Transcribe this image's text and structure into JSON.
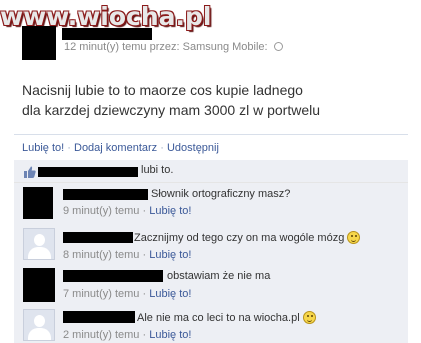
{
  "watermark": "www.wiocha.pl",
  "post": {
    "meta_time": "12 minut(y) temu przez:",
    "meta_source": "Samsung Mobile",
    "meta_dot": "·",
    "text": "Nacisnij lubie to to maorze cos kupie ladnego dla karzdej dziewczyny mam 3000 zl w portwelu"
  },
  "actions": {
    "like": "Lubię to!",
    "comment": "Dodaj komentarz",
    "share": "Udostępnij",
    "separator": "·"
  },
  "likes": {
    "text": "lubi to."
  },
  "comments": [
    {
      "text": "Słownik ortograficzny masz?",
      "time": "9 minut(y) temu",
      "like": "Lubię to!",
      "smiley": false
    },
    {
      "text": "Zacznijmy od tego czy on ma wogóle mózg",
      "time": "8 minut(y) temu",
      "like": "Lubię to!",
      "smiley": true
    },
    {
      "text": "obstawiam że nie ma",
      "time": "7 minut(y) temu",
      "like": "Lubię to!",
      "smiley": false
    },
    {
      "text": "Ale nie ma co leci to na wiocha.pl",
      "time": "2 minut(y) temu",
      "like": "Lubię to!",
      "smiley": true
    }
  ],
  "colors": {
    "link": "#3b5998",
    "comment_bg": "#edeff4",
    "watermark_outline": "#8a1a1a"
  }
}
